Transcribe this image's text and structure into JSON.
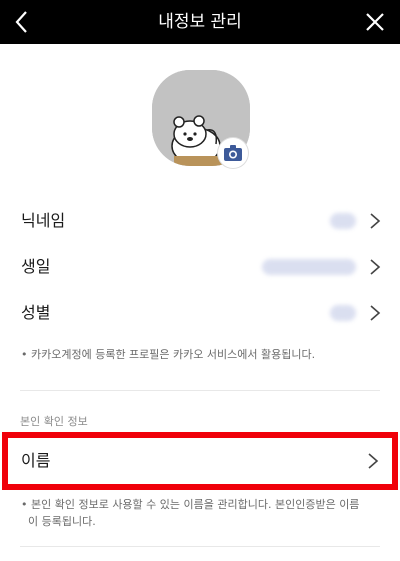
{
  "header": {
    "title": "내정보 관리",
    "back_icon": "chevron-left-icon",
    "close_icon": "close-icon"
  },
  "profile": {
    "avatar": "profile-image",
    "camera_icon": "camera-icon",
    "camera_color": "#3d5a99"
  },
  "rows": [
    {
      "label": "닉네임"
    },
    {
      "label": "생일"
    },
    {
      "label": "성별"
    }
  ],
  "profile_note": "• 카카오계정에 등록한 프로필은 카카오 서비스에서 활용됩니다.",
  "verify_section": {
    "title": "본인 확인 정보",
    "name_label": "이름",
    "note_line1": "• 본인 확인 정보로 사용할 수 있는 이름을 관리합니다. 본인인증받은 이름",
    "note_line2": "이 등록됩니다.",
    "highlight_color": "#f0000a"
  }
}
